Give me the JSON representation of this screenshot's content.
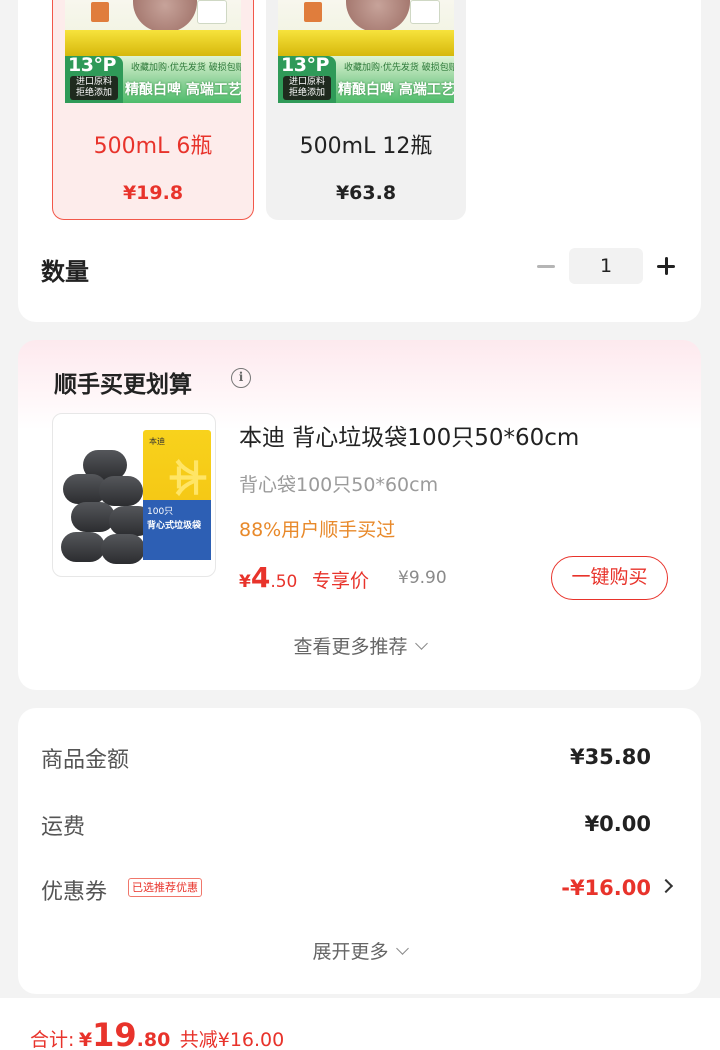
{
  "variants": [
    {
      "name": "500mL 6瓶",
      "price": "¥19.8",
      "selected": true,
      "image": {
        "badge": "13°P",
        "tag_lines": [
          "进口原料",
          "拒绝添加"
        ],
        "tagline": "收藏加购·优先发货 破损包赔",
        "slogan": "精酿白啤  高端工艺"
      }
    },
    {
      "name": "500mL 12瓶",
      "price": "¥63.8",
      "selected": false,
      "image": {
        "badge": "13°P",
        "tag_lines": [
          "进口原料",
          "拒绝添加"
        ],
        "tagline": "收藏加购·优先发货 破损包赔",
        "slogan": "精酿白啤  高端工艺"
      }
    }
  ],
  "quantity": {
    "label": "数量",
    "value": "1",
    "minus_icon": "minus-icon",
    "plus_icon": "plus-icon"
  },
  "addon": {
    "title": "顺手买更划算",
    "info_icon": "info-icon",
    "product": {
      "name": "本迪 背心垃圾袋100只50*60cm",
      "spec": "背心袋100只50*60cm",
      "social_proof": "88%用户顺手买过",
      "price_currency": "¥",
      "price_int": "4",
      "price_dec": ".50",
      "price_tag": "专享价",
      "original_price": "¥9.90",
      "image": {
        "pack_count": "100只",
        "pack_title": "背心式垃圾袋",
        "pack_brand": "本迪"
      }
    },
    "buy_button": "一键购买",
    "more": "查看更多推荐"
  },
  "summary": {
    "rows": [
      {
        "label": "商品金额",
        "value": "¥35.80"
      },
      {
        "label": "运费",
        "value": "¥0.00"
      }
    ],
    "coupon": {
      "label": "优惠券",
      "badge": "已选推荐优惠",
      "value": "-¥16.00"
    },
    "expand": "展开更多"
  },
  "bottom": {
    "total_label": "合计:",
    "currency": "¥",
    "total_int": "19",
    "total_dec": ".80",
    "saved": "共减¥16.00"
  },
  "colors": {
    "accent": "#e8332b",
    "social": "#e8892a",
    "selected_bg": "#fdeceb"
  }
}
